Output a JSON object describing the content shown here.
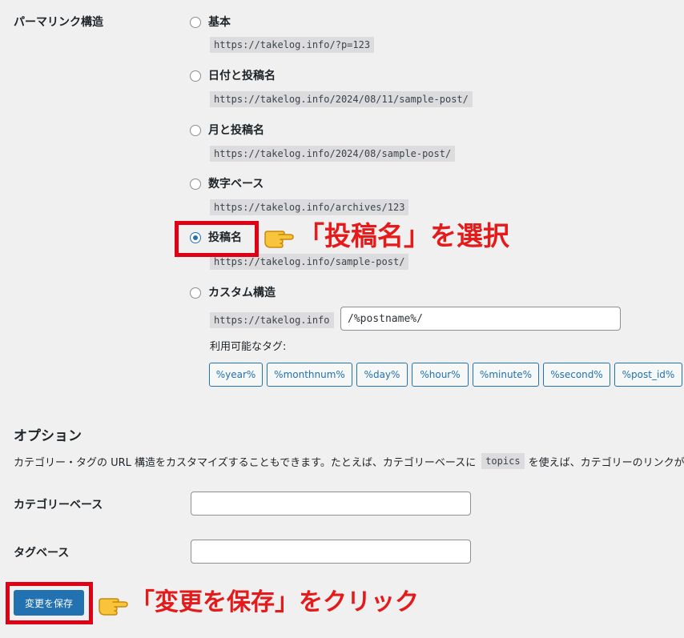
{
  "permalink": {
    "section_label": "パーマリンク構造",
    "options": [
      {
        "label": "基本",
        "example": "https://takelog.info/?p=123",
        "checked": false
      },
      {
        "label": "日付と投稿名",
        "example": "https://takelog.info/2024/08/11/sample-post/",
        "checked": false
      },
      {
        "label": "月と投稿名",
        "example": "https://takelog.info/2024/08/sample-post/",
        "checked": false
      },
      {
        "label": "数字ベース",
        "example": "https://takelog.info/archives/123",
        "checked": false
      },
      {
        "label": "投稿名",
        "example": "https://takelog.info/sample-post/",
        "checked": true
      },
      {
        "label": "カスタム構造",
        "example": "https://takelog.info",
        "checked": false
      }
    ],
    "custom_structure_value": "/%postname%/",
    "available_tags_label": "利用可能なタグ:",
    "tags": [
      "%year%",
      "%monthnum%",
      "%day%",
      "%hour%",
      "%minute%",
      "%second%",
      "%post_id%"
    ]
  },
  "optional": {
    "heading": "オプション",
    "description_before": "カテゴリー・タグの URL 構造をカスタマイズすることもできます。たとえば、カテゴリーベースに",
    "description_code": "topics",
    "description_after": "を使えば、カテゴリーのリンクが",
    "category_base_label": "カテゴリーベース",
    "category_base_value": "",
    "tag_base_label": "タグベース",
    "tag_base_value": ""
  },
  "save_button_label": "変更を保存",
  "annotations": {
    "select_text": "「投稿名」を選択",
    "click_text": "「変更を保存」をクリック",
    "color": "#e51a1a"
  },
  "colors": {
    "accent": "#2271b1",
    "highlight_box": "#e00016",
    "background": "#f0f0f1"
  }
}
